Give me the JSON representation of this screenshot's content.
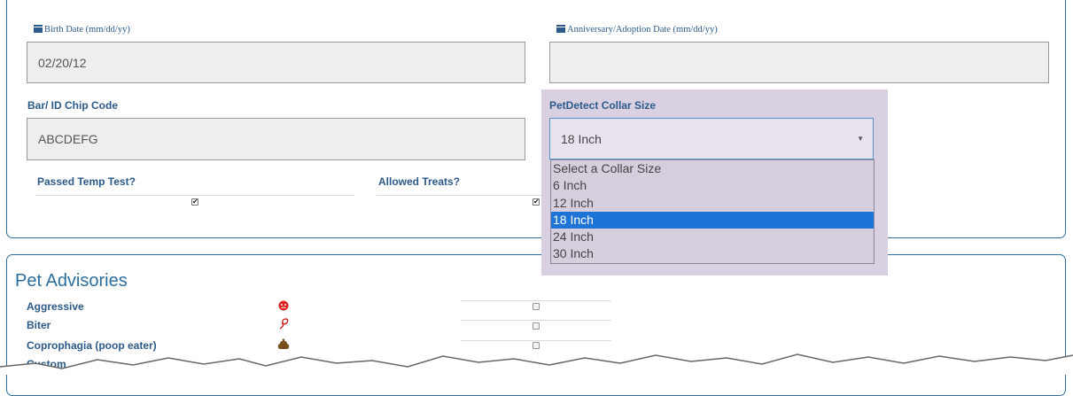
{
  "dates": {
    "birth_label": "Birth  Date  (mm/dd/yy)",
    "birth_value": "02/20/12",
    "anniversary_label": "Anniversary/Adoption  Date  (mm/dd/yy)",
    "anniversary_value": ""
  },
  "chip": {
    "label": "Bar/ ID Chip Code",
    "value": "ABCDEFG"
  },
  "collar": {
    "label": "PetDetect Collar Size",
    "selected": "18 Inch",
    "options": [
      "Select a Collar Size",
      "6 Inch",
      "12 Inch",
      "18 Inch",
      "24 Inch",
      "30 Inch"
    ]
  },
  "checks": {
    "temp_label": "Passed Temp Test?",
    "treats_label": "Allowed Treats?",
    "temp_checked": true,
    "treats_checked": true
  },
  "advisories": {
    "title": "Pet Advisories",
    "items": [
      {
        "label": "Aggressive",
        "icon": "angry-face-icon",
        "color": "#e0201e"
      },
      {
        "label": "Biter",
        "icon": "bite-icon",
        "color": "#cc2222"
      },
      {
        "label": "Coprophagia (poop eater)",
        "icon": "poop-icon",
        "color": "#8a5a20"
      },
      {
        "label": "Custom",
        "icon": "",
        "color": "#2c5a8a"
      }
    ]
  },
  "colors": {
    "accent": "#2c5a8a",
    "panel_border": "#2f6f9c",
    "highlight": "#1e74d6",
    "overlay": "#d9d0e2"
  }
}
